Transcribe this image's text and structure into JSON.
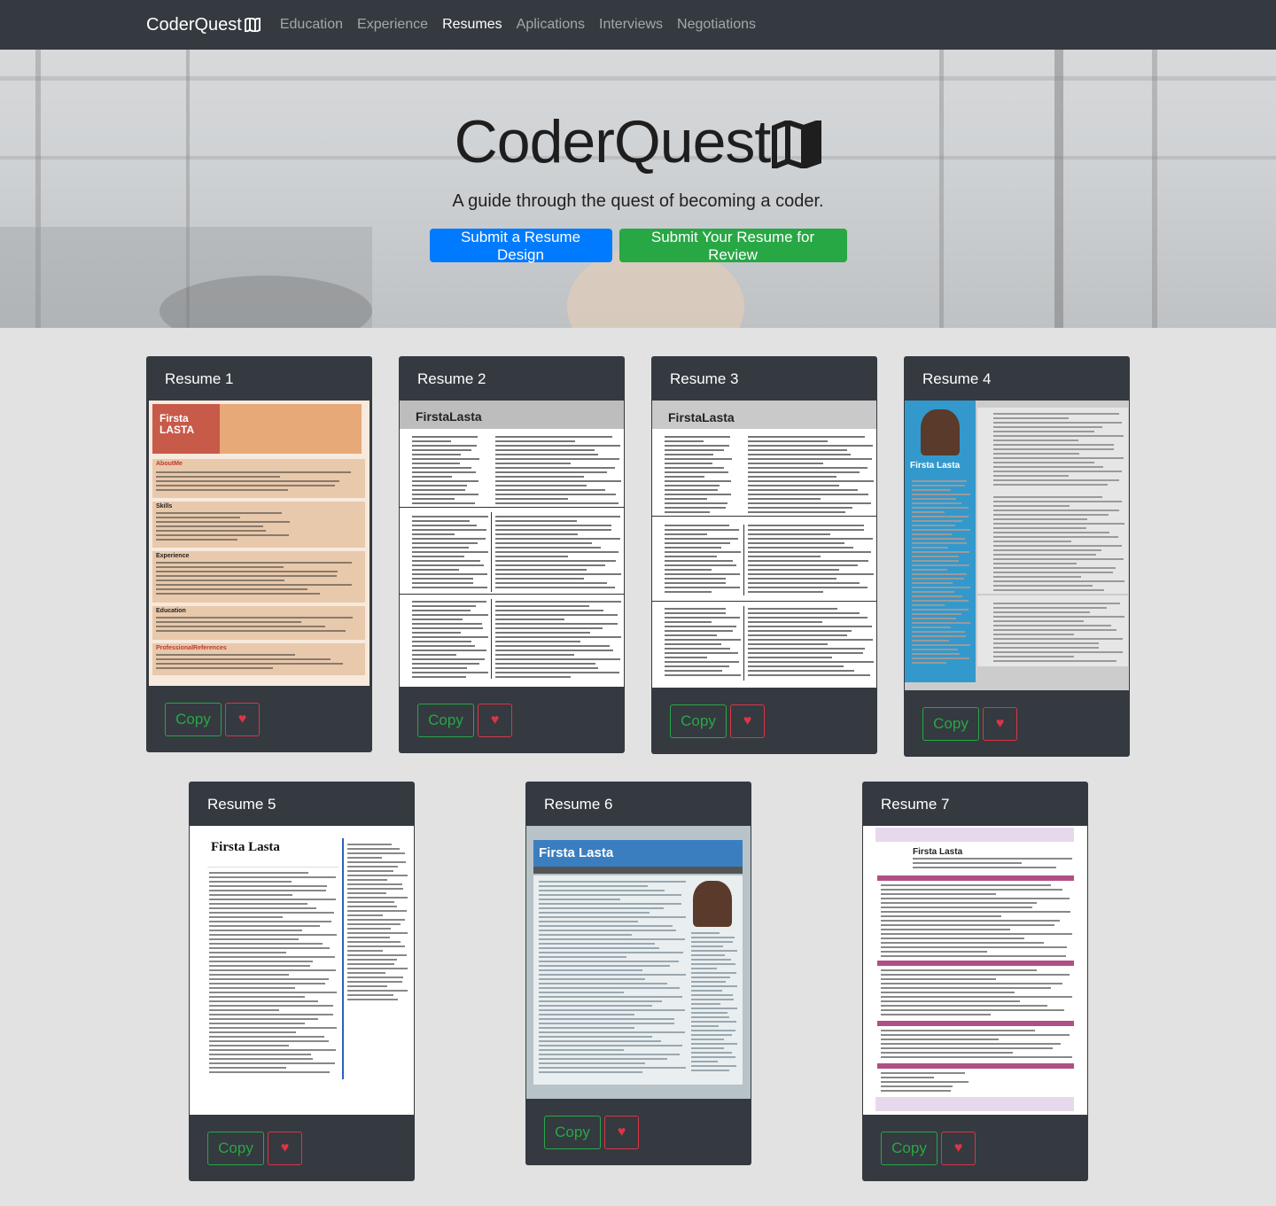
{
  "nav": {
    "brand": "CoderQuest",
    "links": [
      {
        "label": "Education",
        "active": false
      },
      {
        "label": "Experience",
        "active": false
      },
      {
        "label": "Resumes",
        "active": true
      },
      {
        "label": "Aplications",
        "active": false
      },
      {
        "label": "Interviews",
        "active": false
      },
      {
        "label": "Negotiations",
        "active": false
      }
    ]
  },
  "hero": {
    "title": "CoderQuest",
    "subtitle": "A guide through the quest of becoming a coder.",
    "primary_button": "Submit a Resume Design",
    "secondary_button": "Submit Your Resume for Review"
  },
  "cards": [
    {
      "title": "Resume 1",
      "copy_label": "Copy",
      "name": "Firsta LASTA"
    },
    {
      "title": "Resume 2",
      "copy_label": "Copy",
      "name": "FirstaLasta"
    },
    {
      "title": "Resume 3",
      "copy_label": "Copy",
      "name": "FirstaLasta"
    },
    {
      "title": "Resume 4",
      "copy_label": "Copy",
      "name": "Firsta Lasta"
    },
    {
      "title": "Resume 5",
      "copy_label": "Copy",
      "name": "Firsta Lasta"
    },
    {
      "title": "Resume 6",
      "copy_label": "Copy",
      "name": "Firsta Lasta"
    },
    {
      "title": "Resume 7",
      "copy_label": "Copy",
      "name": "Firsta Lasta"
    }
  ],
  "colors": {
    "navbar": "#343a40",
    "primary": "#007bff",
    "success": "#28a745",
    "danger": "#dc3545"
  },
  "icons": {
    "brand_icon": "map-icon",
    "heart": "heart-icon"
  }
}
